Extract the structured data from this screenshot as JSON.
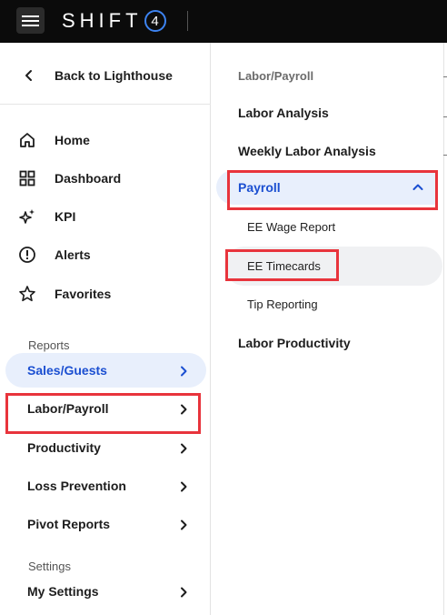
{
  "header": {
    "brand_text": "SHIFT",
    "brand_number": "4",
    "menu_icon": "hamburger-icon"
  },
  "sidebar": {
    "back_label": "Back to Lighthouse",
    "nav_items": [
      {
        "label": "Home",
        "icon": "home-icon"
      },
      {
        "label": "Dashboard",
        "icon": "dashboard-grid-icon"
      },
      {
        "label": "KPI",
        "icon": "sparkle-icon"
      },
      {
        "label": "Alerts",
        "icon": "alert-circle-icon"
      },
      {
        "label": "Favorites",
        "icon": "star-icon"
      }
    ],
    "reports_heading": "Reports",
    "reports": [
      {
        "label": "Sales/Guests",
        "active": true
      },
      {
        "label": "Labor/Payroll",
        "highlighted": true
      },
      {
        "label": "Productivity"
      },
      {
        "label": "Loss Prevention"
      },
      {
        "label": "Pivot Reports"
      }
    ],
    "settings_heading": "Settings",
    "settings": [
      {
        "label": "My Settings"
      }
    ]
  },
  "submenu": {
    "heading": "Labor/Payroll",
    "items": [
      {
        "label": "Labor Analysis"
      },
      {
        "label": "Weekly Labor Analysis"
      },
      {
        "label": "Payroll",
        "expanded": true,
        "highlighted": true
      },
      {
        "label": "Labor Productivity"
      }
    ],
    "payroll_children": [
      {
        "label": "EE Wage Report"
      },
      {
        "label": "EE Timecards",
        "selected": true,
        "highlighted": true
      },
      {
        "label": "Tip Reporting"
      }
    ]
  },
  "colors": {
    "topbar": "#0b0b0b",
    "accent_blue": "#1b4fd1",
    "active_bg": "#e8effc",
    "highlight_red": "#e8343c"
  }
}
